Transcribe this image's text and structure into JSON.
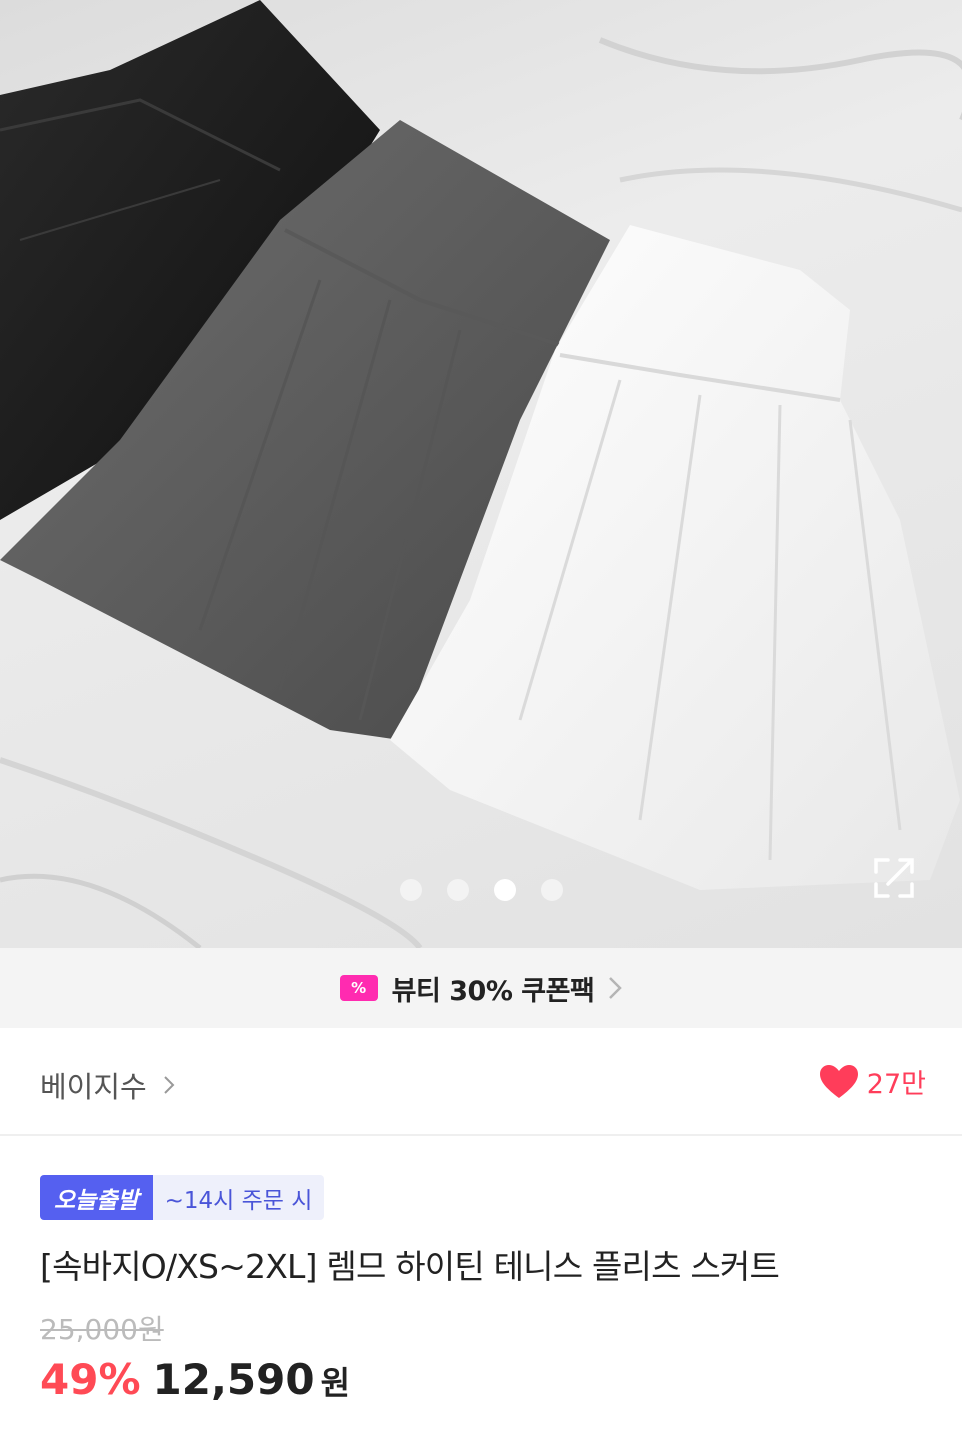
{
  "gallery": {
    "image_alt": "plaid tennis pleats skirt product photo",
    "dots": [
      false,
      false,
      true,
      false
    ],
    "expand_icon": "expand-icon"
  },
  "coupon": {
    "icon": "coupon-icon",
    "icon_glyph": "%",
    "text": "뷰티 30% 쿠폰팩",
    "color": "#ff2bb0"
  },
  "shop": {
    "name": "베이지수",
    "like_count": "27만",
    "heart_color": "#ff3d5a"
  },
  "product": {
    "badge_primary": "오늘출발",
    "badge_secondary": "~14시 주문 시",
    "title": "[속바지O/XS~2XL] 렘므 하이틴 테니스 플리츠 스커트",
    "original_price": "25,000원",
    "discount": "49%",
    "price": "12,590",
    "currency": "원"
  }
}
